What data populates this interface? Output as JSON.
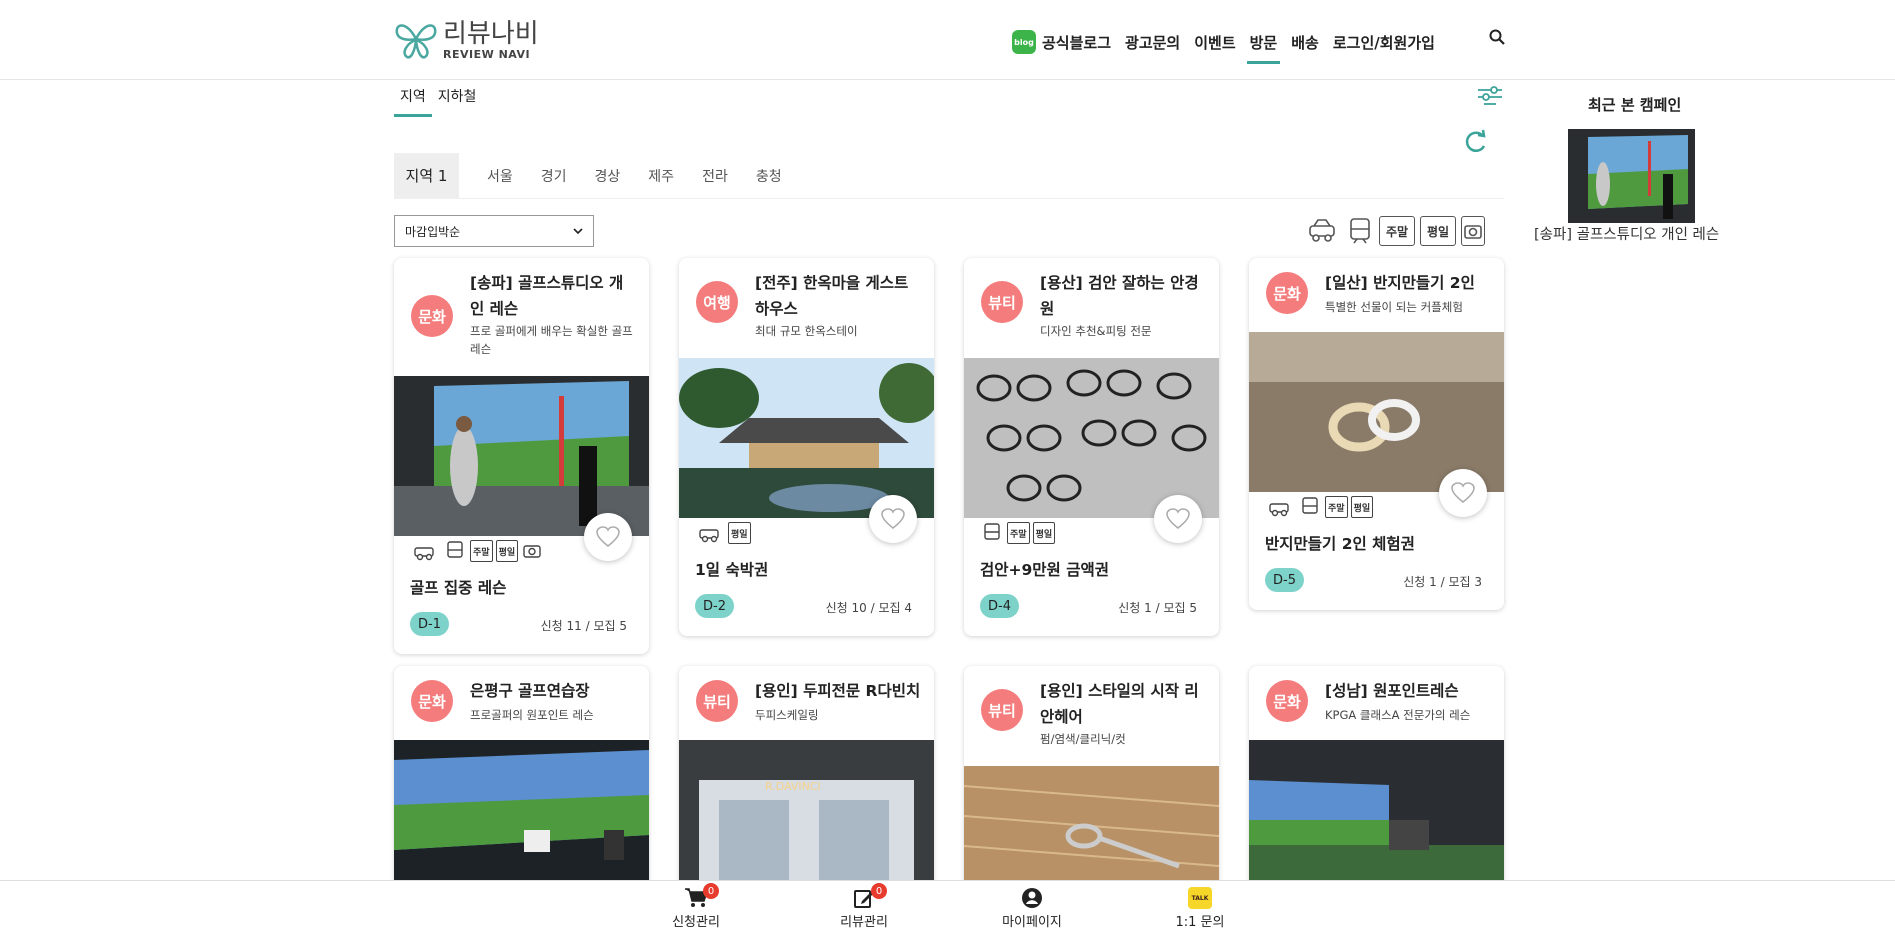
{
  "header": {
    "logo_ko": "리뷰나비",
    "logo_en": "REVIEW NAVI",
    "nav": [
      "공식블로그",
      "광고문의",
      "이벤트",
      "방문",
      "배송",
      "로그인/회원가입"
    ],
    "active_nav": "방문",
    "blog_icon_text": "blog",
    "accent": "#3aa39a"
  },
  "tabs": [
    "지역",
    "지하철"
  ],
  "region_label": "지역 1",
  "regions": [
    "서울",
    "경기",
    "경상",
    "제주",
    "전라",
    "충청"
  ],
  "sort": {
    "selected": "마감입박순"
  },
  "legend": [
    "주말",
    "평일"
  ],
  "cards": [
    {
      "badge": "문화",
      "title": "[송파] 골프스튜디오 개인 레슨",
      "subtitle": "프로 골퍼에게 배우는 확실한 골프 레슨",
      "product": "골프 집중 레슨",
      "dday": "D-1",
      "count": "신청 11 / 모집 5",
      "tags": [
        "car",
        "subway",
        "주말",
        "평일",
        "camera"
      ]
    },
    {
      "badge": "여행",
      "title": "[전주] 한옥마을 게스트하우스",
      "subtitle": "최대 규모 한옥스테이",
      "product": "1일 숙박권",
      "dday": "D-2",
      "count": "신청 10 / 모집 4",
      "tags": [
        "car",
        "평일"
      ]
    },
    {
      "badge": "뷰티",
      "title": "[용산] 검안 잘하는 안경원",
      "subtitle": "디자인 추천&피팅 전문",
      "product": "검안+9만원 금액권",
      "dday": "D-4",
      "count": "신청 1 / 모집 5",
      "tags": [
        "subway",
        "주말",
        "평일"
      ]
    },
    {
      "badge": "문화",
      "title": "[일산] 반지만들기 2인",
      "subtitle": "특별한 선물이 되는 커플체험",
      "product": "반지만들기 2인 체험권",
      "dday": "D-5",
      "count": "신청 1 / 모집 3",
      "tags": [
        "car",
        "subway",
        "주말",
        "평일"
      ]
    },
    {
      "badge": "문화",
      "title": "은평구 골프연습장",
      "subtitle": "프로골퍼의 원포인트 레슨"
    },
    {
      "badge": "뷰티",
      "title": "[용인] 두피전문 R다빈치",
      "subtitle": "두피스케일링",
      "img_text": "R.DAVINCI"
    },
    {
      "badge": "뷰티",
      "title": "[용인] 스타일의 시작 리안헤어",
      "subtitle": "펌/염색/클리닉/컷"
    },
    {
      "badge": "문화",
      "title": "[성남] 원포인트레슨",
      "subtitle": "KPGA 클래스A 전문가의 레슨"
    }
  ],
  "recent": {
    "title": "최근 본 캠페인",
    "caption": "[송파] 골프스튜디오 개인 레슨"
  },
  "bottom": [
    {
      "label": "신청관리",
      "count": "0"
    },
    {
      "label": "리뷰관리",
      "count": "0"
    },
    {
      "label": "마이페이지"
    },
    {
      "label": "1:1 문의",
      "talk": "TALK"
    }
  ],
  "colors": {
    "badge": "#f47c7c",
    "dday": "#7dd3ca",
    "notify": "#e73b2d"
  }
}
